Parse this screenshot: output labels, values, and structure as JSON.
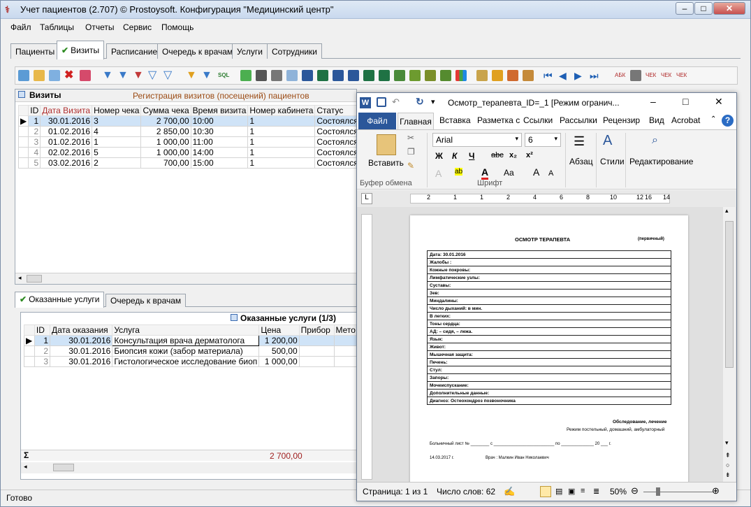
{
  "app": {
    "title": "Учет пациентов (2.707) © Prostoysoft. Конфигурация \"Медицинский центр\"",
    "menu": [
      "Файл",
      "Таблицы",
      "Отчеты",
      "Сервис",
      "Помощь"
    ],
    "tabs": [
      "Пациенты",
      "Визиты",
      "Расписание",
      "Очередь к врачам",
      "Услуги",
      "Сотрудники"
    ],
    "active_tab": "Визиты"
  },
  "visits": {
    "title": "Визиты",
    "subtitle": "Регистрация визитов (посещений) пациентов",
    "columns": [
      "ID",
      "Дата Визита",
      "Номер чека",
      "Сумма чека",
      "Время визита",
      "Номер кабинета",
      "Статус"
    ],
    "rows": [
      {
        "id": "1",
        "date": "30.01.2016",
        "check_no": "3",
        "sum": "2 700,00",
        "time": "10:00",
        "room": "1",
        "status": "Состоялся"
      },
      {
        "id": "2",
        "date": "01.02.2016",
        "check_no": "4",
        "sum": "2 850,00",
        "time": "10:30",
        "room": "1",
        "status": "Состоялся"
      },
      {
        "id": "3",
        "date": "01.02.2016",
        "check_no": "1",
        "sum": "1 000,00",
        "time": "11:00",
        "room": "1",
        "status": "Состоялся"
      },
      {
        "id": "4",
        "date": "02.02.2016",
        "check_no": "5",
        "sum": "1 000,00",
        "time": "14:00",
        "room": "1",
        "status": "Состоялся"
      },
      {
        "id": "5",
        "date": "03.02.2016",
        "check_no": "2",
        "sum": "700,00",
        "time": "15:00",
        "room": "1",
        "status": "Состоялся"
      }
    ]
  },
  "services": {
    "tabs": [
      "Оказанные услуги",
      "Очередь к врачам"
    ],
    "title": "Оказанные услуги (1/3)",
    "columns": [
      "ID",
      "Дата оказания",
      "Услуга",
      "Цена",
      "Прибор",
      "Мето"
    ],
    "rows": [
      {
        "id": "1",
        "date": "30.01.2016",
        "service": "Консультация врача дерматолога",
        "price": "1 200,00"
      },
      {
        "id": "2",
        "date": "30.01.2016",
        "service": "Биопсия кожи (забор материала)",
        "price": "500,00"
      },
      {
        "id": "3",
        "date": "30.01.2016",
        "service": "Гистологическое исследование биоп",
        "price": "1 000,00"
      }
    ],
    "sum_symbol": "Σ",
    "total": "2 700,00"
  },
  "status_bar": "Готово",
  "word": {
    "title": "Осмотр_терапевта_ID=_1 [Режим огранич...",
    "ribbon_tabs": [
      "Файл",
      "Главная",
      "Вставка",
      "Разметка с",
      "Ссылки",
      "Рассылки",
      "Рецензир",
      "Вид",
      "Acrobat"
    ],
    "paste_label": "Вставить",
    "font": "Arial",
    "size": "6",
    "paragraph_label": "Абзац",
    "styles_label": "Стили",
    "editing_label": "Редактирование",
    "clipboard_label": "Буфер обмена",
    "font_group_label": "Шрифт",
    "ruler_numbers": [
      "1",
      "2",
      "1",
      "2",
      "4",
      "6",
      "8",
      "10",
      "12",
      "14",
      "16"
    ],
    "doc": {
      "heading": "ОСМОТР ТЕРАПЕВТА",
      "heading_note": "(первичный)",
      "rows": [
        "Дата: 30.01.2016",
        "Жалобы :",
        "Кожные покровы:",
        "Лимфатические узлы:",
        "Суставы:",
        "Зев:",
        "Миндалины:",
        "Число дыханий:   в мин.",
        "В легких:",
        "Тоны сердца:",
        "АД:   – сидя,   – лежа.",
        "Язык:",
        "Живот:",
        "Мышечная защита:",
        "Печень:",
        "Стул:",
        "Запоры:",
        "Мочеиспускание:",
        "Дополнительные данные:",
        "Диагноз: Остеохондроз позвоночника"
      ],
      "exam_title": "Обследование, лечение",
      "regime": "Режим постельный, домашний, амбулаторный",
      "sick_leave": "Больничный лист № ________ с __________________________ по ______________ 20 ___ г.",
      "date": "14.03.2017 г.",
      "doctor": "Врач : Малкин Иван Николаевич"
    },
    "status": {
      "page": "Страница: 1 из 1",
      "words": "Число слов: 62",
      "zoom": "50%"
    }
  }
}
